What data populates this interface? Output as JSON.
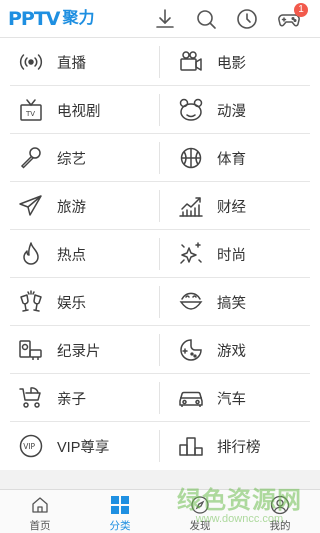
{
  "header": {
    "logo_mark": "PPTV",
    "logo_text": "聚力",
    "icons": [
      "download-icon",
      "search-icon",
      "history-icon",
      "game-icon"
    ],
    "game_badge": "1"
  },
  "categories": [
    {
      "left": {
        "label": "直播",
        "icon": "live-icon"
      },
      "right": {
        "label": "电影",
        "icon": "movie-camera-icon"
      }
    },
    {
      "left": {
        "label": "电视剧",
        "icon": "tv-icon"
      },
      "right": {
        "label": "动漫",
        "icon": "cartoon-icon"
      }
    },
    {
      "left": {
        "label": "综艺",
        "icon": "microphone-icon"
      },
      "right": {
        "label": "体育",
        "icon": "ball-icon"
      }
    },
    {
      "left": {
        "label": "旅游",
        "icon": "paper-plane-icon"
      },
      "right": {
        "label": "财经",
        "icon": "finance-chart-icon"
      }
    },
    {
      "left": {
        "label": "热点",
        "icon": "flame-icon"
      },
      "right": {
        "label": "时尚",
        "icon": "sparkle-icon"
      }
    },
    {
      "left": {
        "label": "娱乐",
        "icon": "cheers-icon"
      },
      "right": {
        "label": "搞笑",
        "icon": "smile-icon"
      }
    },
    {
      "left": {
        "label": "纪录片",
        "icon": "documentary-icon"
      },
      "right": {
        "label": "游戏",
        "icon": "gamepad-icon"
      }
    },
    {
      "left": {
        "label": "亲子",
        "icon": "stroller-icon"
      },
      "right": {
        "label": "汽车",
        "icon": "car-icon"
      }
    },
    {
      "left": {
        "label": "VIP尊享",
        "icon": "vip-icon"
      },
      "right": {
        "label": "排行榜",
        "icon": "ranking-icon"
      }
    }
  ],
  "bottom_nav": [
    {
      "label": "首页",
      "icon": "home-icon",
      "active": false
    },
    {
      "label": "分类",
      "icon": "category-grid-icon",
      "active": true
    },
    {
      "label": "发现",
      "icon": "discover-icon",
      "active": false
    },
    {
      "label": "我的",
      "icon": "profile-icon",
      "active": false
    }
  ],
  "watermark": {
    "big": "绿色资源网",
    "small": "www.downcc.com"
  },
  "colors": {
    "accent": "#1e8fe1",
    "icon_stroke": "#444444",
    "badge": "#f25a4c"
  }
}
